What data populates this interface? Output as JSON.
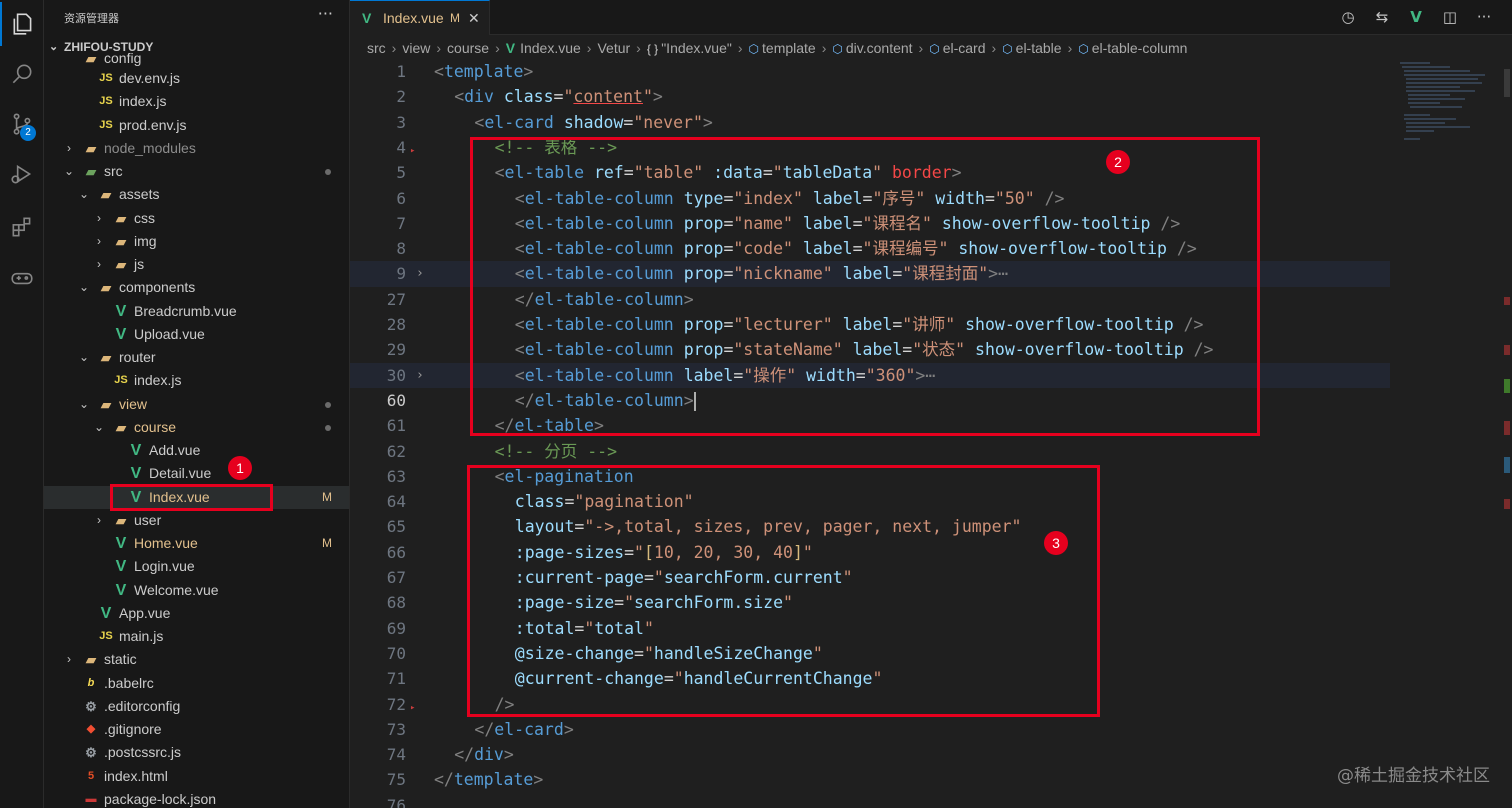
{
  "activity_bar": {
    "items": [
      {
        "icon": "files-icon",
        "active": true
      },
      {
        "icon": "search-icon"
      },
      {
        "icon": "source-control-icon",
        "badge": "2"
      },
      {
        "icon": "run-debug-icon"
      },
      {
        "icon": "extensions-icon"
      },
      {
        "icon": "remote-gamepad-icon"
      }
    ]
  },
  "sidebar": {
    "title": "资源管理器",
    "more": "···",
    "project": "ZHIFOU-STUDY",
    "tree": [
      {
        "name": "config",
        "icon": "folder",
        "indent": 1,
        "partial": true
      },
      {
        "name": "dev.env.js",
        "icon": "JS",
        "indent": 2
      },
      {
        "name": "index.js",
        "icon": "JS",
        "indent": 2
      },
      {
        "name": "prod.env.js",
        "icon": "JS",
        "indent": 2
      },
      {
        "name": "node_modules",
        "icon": "folder",
        "indent": 1,
        "chev": "›",
        "dim": true
      },
      {
        "name": "src",
        "icon": "folder-src",
        "indent": 1,
        "chev": "⌄",
        "dot": true
      },
      {
        "name": "assets",
        "icon": "folder",
        "indent": 2,
        "chev": "⌄"
      },
      {
        "name": "css",
        "icon": "folder",
        "indent": 3,
        "chev": "›"
      },
      {
        "name": "img",
        "icon": "folder",
        "indent": 3,
        "chev": "›"
      },
      {
        "name": "js",
        "icon": "folder",
        "indent": 3,
        "chev": "›"
      },
      {
        "name": "components",
        "icon": "folder",
        "indent": 2,
        "chev": "⌄"
      },
      {
        "name": "Breadcrumb.vue",
        "icon": "V",
        "indent": 3
      },
      {
        "name": "Upload.vue",
        "icon": "V",
        "indent": 3
      },
      {
        "name": "router",
        "icon": "folder",
        "indent": 2,
        "chev": "⌄"
      },
      {
        "name": "index.js",
        "icon": "JS",
        "indent": 3
      },
      {
        "name": "view",
        "icon": "folder",
        "indent": 2,
        "chev": "⌄",
        "modified": true,
        "dot": true
      },
      {
        "name": "course",
        "icon": "folder",
        "indent": 3,
        "chev": "⌄",
        "modified": true,
        "dot": true
      },
      {
        "name": "Add.vue",
        "icon": "V",
        "indent": 4
      },
      {
        "name": "Detail.vue",
        "icon": "V",
        "indent": 4
      },
      {
        "name": "Index.vue",
        "icon": "V",
        "indent": 4,
        "modified": true,
        "status": "M",
        "selected": true
      },
      {
        "name": "user",
        "icon": "folder",
        "indent": 3,
        "chev": "›"
      },
      {
        "name": "Home.vue",
        "icon": "V",
        "indent": 3,
        "modified": true,
        "status": "M"
      },
      {
        "name": "Login.vue",
        "icon": "V",
        "indent": 3
      },
      {
        "name": "Welcome.vue",
        "icon": "V",
        "indent": 3
      },
      {
        "name": "App.vue",
        "icon": "V",
        "indent": 2
      },
      {
        "name": "main.js",
        "icon": "JS",
        "indent": 2
      },
      {
        "name": "static",
        "icon": "folder",
        "indent": 1,
        "chev": "›"
      },
      {
        "name": ".babelrc",
        "icon": "babel",
        "indent": 1
      },
      {
        "name": ".editorconfig",
        "icon": "gear",
        "indent": 1
      },
      {
        "name": ".gitignore",
        "icon": "git",
        "indent": 1
      },
      {
        "name": ".postcssrc.js",
        "icon": "gear",
        "indent": 1
      },
      {
        "name": "index.html",
        "icon": "html",
        "indent": 1
      },
      {
        "name": "package-lock.json",
        "icon": "npm",
        "indent": 1
      }
    ]
  },
  "tab": {
    "label": "Index.vue",
    "status": "M",
    "close": "✕"
  },
  "breadcrumbs": [
    {
      "text": "src"
    },
    {
      "text": "view"
    },
    {
      "text": "course"
    },
    {
      "text": "Index.vue",
      "icon": "V"
    },
    {
      "text": "Vetur"
    },
    {
      "text": "\"Index.vue\"",
      "icon": "{ }"
    },
    {
      "text": "template",
      "icon": "cube"
    },
    {
      "text": "div.content",
      "icon": "cube"
    },
    {
      "text": "el-card",
      "icon": "cube"
    },
    {
      "text": "el-table",
      "icon": "cube"
    },
    {
      "text": "el-table-column",
      "icon": "cube"
    }
  ],
  "code_lines": [
    {
      "n": "1",
      "indent": 0,
      "tokens": [
        [
          "tk-punct",
          "<"
        ],
        [
          "tk-tag",
          "template"
        ],
        [
          "tk-punct",
          ">"
        ]
      ]
    },
    {
      "n": "2",
      "indent": 1,
      "tokens": [
        [
          "tk-punct",
          "<"
        ],
        [
          "tk-tag",
          "div "
        ],
        [
          "tk-attr",
          "class"
        ],
        [
          "tk-plain",
          "="
        ],
        [
          "tk-str",
          "\""
        ],
        [
          "tk-str tk-err",
          "content"
        ],
        [
          "tk-str",
          "\""
        ],
        [
          "tk-punct",
          ">"
        ]
      ]
    },
    {
      "n": "3",
      "indent": 2,
      "tokens": [
        [
          "tk-punct",
          "<"
        ],
        [
          "tk-tag",
          "el-card "
        ],
        [
          "tk-attr",
          "shadow"
        ],
        [
          "tk-plain",
          "="
        ],
        [
          "tk-str",
          "\"never\""
        ],
        [
          "tk-punct",
          ">"
        ]
      ]
    },
    {
      "n": "4",
      "indent": 3,
      "tokens": [
        [
          "tk-comment",
          "<!-- 表格 -->"
        ]
      ],
      "mark": true
    },
    {
      "n": "5",
      "indent": 3,
      "tokens": [
        [
          "tk-punct",
          "<"
        ],
        [
          "tk-tag",
          "el-table "
        ],
        [
          "tk-attr",
          "ref"
        ],
        [
          "tk-plain",
          "="
        ],
        [
          "tk-str",
          "\"table\" "
        ],
        [
          "tk-attr",
          ":data"
        ],
        [
          "tk-plain",
          "="
        ],
        [
          "tk-str",
          "\""
        ],
        [
          "tk-attr",
          "tableData"
        ],
        [
          "tk-str",
          "\" "
        ],
        [
          "tk-red",
          "border"
        ],
        [
          "tk-punct",
          ">"
        ]
      ]
    },
    {
      "n": "6",
      "indent": 4,
      "tokens": [
        [
          "tk-punct",
          "<"
        ],
        [
          "tk-tag",
          "el-table-column "
        ],
        [
          "tk-attr",
          "type"
        ],
        [
          "tk-plain",
          "="
        ],
        [
          "tk-str",
          "\"index\" "
        ],
        [
          "tk-attr",
          "label"
        ],
        [
          "tk-plain",
          "="
        ],
        [
          "tk-str",
          "\"序号\" "
        ],
        [
          "tk-attr",
          "width"
        ],
        [
          "tk-plain",
          "="
        ],
        [
          "tk-str",
          "\"50\" "
        ],
        [
          "tk-punct",
          "/>"
        ]
      ]
    },
    {
      "n": "7",
      "indent": 4,
      "tokens": [
        [
          "tk-punct",
          "<"
        ],
        [
          "tk-tag",
          "el-table-column "
        ],
        [
          "tk-attr",
          "prop"
        ],
        [
          "tk-plain",
          "="
        ],
        [
          "tk-str",
          "\"name\" "
        ],
        [
          "tk-attr",
          "label"
        ],
        [
          "tk-plain",
          "="
        ],
        [
          "tk-str",
          "\"课程名\" "
        ],
        [
          "tk-attr",
          "show-overflow-tooltip "
        ],
        [
          "tk-punct",
          "/>"
        ]
      ]
    },
    {
      "n": "8",
      "indent": 4,
      "tokens": [
        [
          "tk-punct",
          "<"
        ],
        [
          "tk-tag",
          "el-table-column "
        ],
        [
          "tk-attr",
          "prop"
        ],
        [
          "tk-plain",
          "="
        ],
        [
          "tk-str",
          "\"code\" "
        ],
        [
          "tk-attr",
          "label"
        ],
        [
          "tk-plain",
          "="
        ],
        [
          "tk-str",
          "\"课程编号\" "
        ],
        [
          "tk-attr",
          "show-overflow-tooltip "
        ],
        [
          "tk-punct",
          "/>"
        ]
      ]
    },
    {
      "n": "9",
      "indent": 4,
      "fold": true,
      "hl": true,
      "tokens": [
        [
          "tk-punct",
          "<"
        ],
        [
          "tk-tag",
          "el-table-column "
        ],
        [
          "tk-attr",
          "prop"
        ],
        [
          "tk-plain",
          "="
        ],
        [
          "tk-str",
          "\"nickname\" "
        ],
        [
          "tk-attr",
          "label"
        ],
        [
          "tk-plain",
          "="
        ],
        [
          "tk-str",
          "\"课程封面\""
        ],
        [
          "tk-punct",
          ">"
        ],
        [
          "tk-punct",
          "⋯"
        ]
      ]
    },
    {
      "n": "27",
      "indent": 4,
      "tokens": [
        [
          "tk-punct",
          "</"
        ],
        [
          "tk-tag",
          "el-table-column"
        ],
        [
          "tk-punct",
          ">"
        ]
      ]
    },
    {
      "n": "28",
      "indent": 4,
      "tokens": [
        [
          "tk-punct",
          "<"
        ],
        [
          "tk-tag",
          "el-table-column "
        ],
        [
          "tk-attr",
          "prop"
        ],
        [
          "tk-plain",
          "="
        ],
        [
          "tk-str",
          "\"lecturer\" "
        ],
        [
          "tk-attr",
          "label"
        ],
        [
          "tk-plain",
          "="
        ],
        [
          "tk-str",
          "\"讲师\" "
        ],
        [
          "tk-attr",
          "show-overflow-tooltip "
        ],
        [
          "tk-punct",
          "/>"
        ]
      ]
    },
    {
      "n": "29",
      "indent": 4,
      "tokens": [
        [
          "tk-punct",
          "<"
        ],
        [
          "tk-tag",
          "el-table-column "
        ],
        [
          "tk-attr",
          "prop"
        ],
        [
          "tk-plain",
          "="
        ],
        [
          "tk-str",
          "\"stateName\" "
        ],
        [
          "tk-attr",
          "label"
        ],
        [
          "tk-plain",
          "="
        ],
        [
          "tk-str",
          "\"状态\" "
        ],
        [
          "tk-attr",
          "show-overflow-tooltip "
        ],
        [
          "tk-punct",
          "/>"
        ]
      ]
    },
    {
      "n": "30",
      "indent": 4,
      "fold": true,
      "hl": true,
      "tokens": [
        [
          "tk-punct",
          "<"
        ],
        [
          "tk-tag",
          "el-table-column "
        ],
        [
          "tk-attr",
          "label"
        ],
        [
          "tk-plain",
          "="
        ],
        [
          "tk-str",
          "\"操作\" "
        ],
        [
          "tk-attr",
          "width"
        ],
        [
          "tk-plain",
          "="
        ],
        [
          "tk-str",
          "\"360\""
        ],
        [
          "tk-punct",
          ">"
        ],
        [
          "tk-punct",
          "⋯"
        ]
      ]
    },
    {
      "n": "60",
      "indent": 4,
      "cur": true,
      "cursor": true,
      "tokens": [
        [
          "tk-punct",
          "</"
        ],
        [
          "tk-tag",
          "el-table-column"
        ],
        [
          "tk-punct",
          ">"
        ]
      ]
    },
    {
      "n": "61",
      "indent": 3,
      "tokens": [
        [
          "tk-punct",
          "</"
        ],
        [
          "tk-tag",
          "el-table"
        ],
        [
          "tk-punct",
          ">"
        ]
      ]
    },
    {
      "n": "62",
      "indent": 3,
      "tokens": [
        [
          "tk-comment",
          "<!-- 分页 -->"
        ]
      ]
    },
    {
      "n": "63",
      "indent": 3,
      "tokens": [
        [
          "tk-punct",
          "<"
        ],
        [
          "tk-tag",
          "el-pagination"
        ]
      ]
    },
    {
      "n": "64",
      "indent": 4,
      "tokens": [
        [
          "tk-attr",
          "class"
        ],
        [
          "tk-plain",
          "="
        ],
        [
          "tk-str",
          "\"pagination\""
        ]
      ]
    },
    {
      "n": "65",
      "indent": 4,
      "tokens": [
        [
          "tk-attr",
          "layout"
        ],
        [
          "tk-plain",
          "="
        ],
        [
          "tk-str",
          "\"->,total, sizes, prev, pager, next, jumper\""
        ]
      ]
    },
    {
      "n": "66",
      "indent": 4,
      "tokens": [
        [
          "tk-attr",
          ":page-sizes"
        ],
        [
          "tk-plain",
          "="
        ],
        [
          "tk-str",
          "\""
        ],
        [
          "tk-yellow",
          "["
        ],
        [
          "tk-str",
          "10, 20, 30, 40"
        ],
        [
          "tk-yellow",
          "]"
        ],
        [
          "tk-str",
          "\""
        ]
      ]
    },
    {
      "n": "67",
      "indent": 4,
      "tokens": [
        [
          "tk-attr",
          ":current-page"
        ],
        [
          "tk-plain",
          "="
        ],
        [
          "tk-str",
          "\""
        ],
        [
          "tk-attr",
          "searchForm.current"
        ],
        [
          "tk-str",
          "\""
        ]
      ]
    },
    {
      "n": "68",
      "indent": 4,
      "tokens": [
        [
          "tk-attr",
          ":page-size"
        ],
        [
          "tk-plain",
          "="
        ],
        [
          "tk-str",
          "\""
        ],
        [
          "tk-attr",
          "searchForm.size"
        ],
        [
          "tk-str",
          "\""
        ]
      ]
    },
    {
      "n": "69",
      "indent": 4,
      "tokens": [
        [
          "tk-attr",
          ":total"
        ],
        [
          "tk-plain",
          "="
        ],
        [
          "tk-str",
          "\""
        ],
        [
          "tk-attr",
          "total"
        ],
        [
          "tk-str",
          "\""
        ]
      ]
    },
    {
      "n": "70",
      "indent": 4,
      "tokens": [
        [
          "tk-attr",
          "@size-change"
        ],
        [
          "tk-plain",
          "="
        ],
        [
          "tk-str",
          "\""
        ],
        [
          "tk-attr",
          "handleSizeChange"
        ],
        [
          "tk-str",
          "\""
        ]
      ]
    },
    {
      "n": "71",
      "indent": 4,
      "tokens": [
        [
          "tk-attr",
          "@current-change"
        ],
        [
          "tk-plain",
          "="
        ],
        [
          "tk-str",
          "\""
        ],
        [
          "tk-attr",
          "handleCurrentChange"
        ],
        [
          "tk-str",
          "\""
        ]
      ]
    },
    {
      "n": "72",
      "indent": 3,
      "mark": true,
      "tokens": [
        [
          "tk-punct",
          "/>"
        ]
      ]
    },
    {
      "n": "73",
      "indent": 2,
      "tokens": [
        [
          "tk-punct",
          "</"
        ],
        [
          "tk-tag",
          "el-card"
        ],
        [
          "tk-punct",
          ">"
        ]
      ]
    },
    {
      "n": "74",
      "indent": 1,
      "tokens": [
        [
          "tk-punct",
          "</"
        ],
        [
          "tk-tag",
          "div"
        ],
        [
          "tk-punct",
          ">"
        ]
      ]
    },
    {
      "n": "75",
      "indent": 0,
      "tokens": [
        [
          "tk-punct",
          "</"
        ],
        [
          "tk-tag",
          "template"
        ],
        [
          "tk-punct",
          ">"
        ]
      ]
    },
    {
      "n": "76",
      "indent": 0,
      "tokens": []
    }
  ],
  "annotations": [
    "1",
    "2",
    "3"
  ],
  "watermark": "@稀土掘金技术社区",
  "colors": {
    "accent": "#0078d4",
    "annotation_red": "#e6001e",
    "modified": "#e2c08d",
    "vue_green": "#41b883"
  }
}
